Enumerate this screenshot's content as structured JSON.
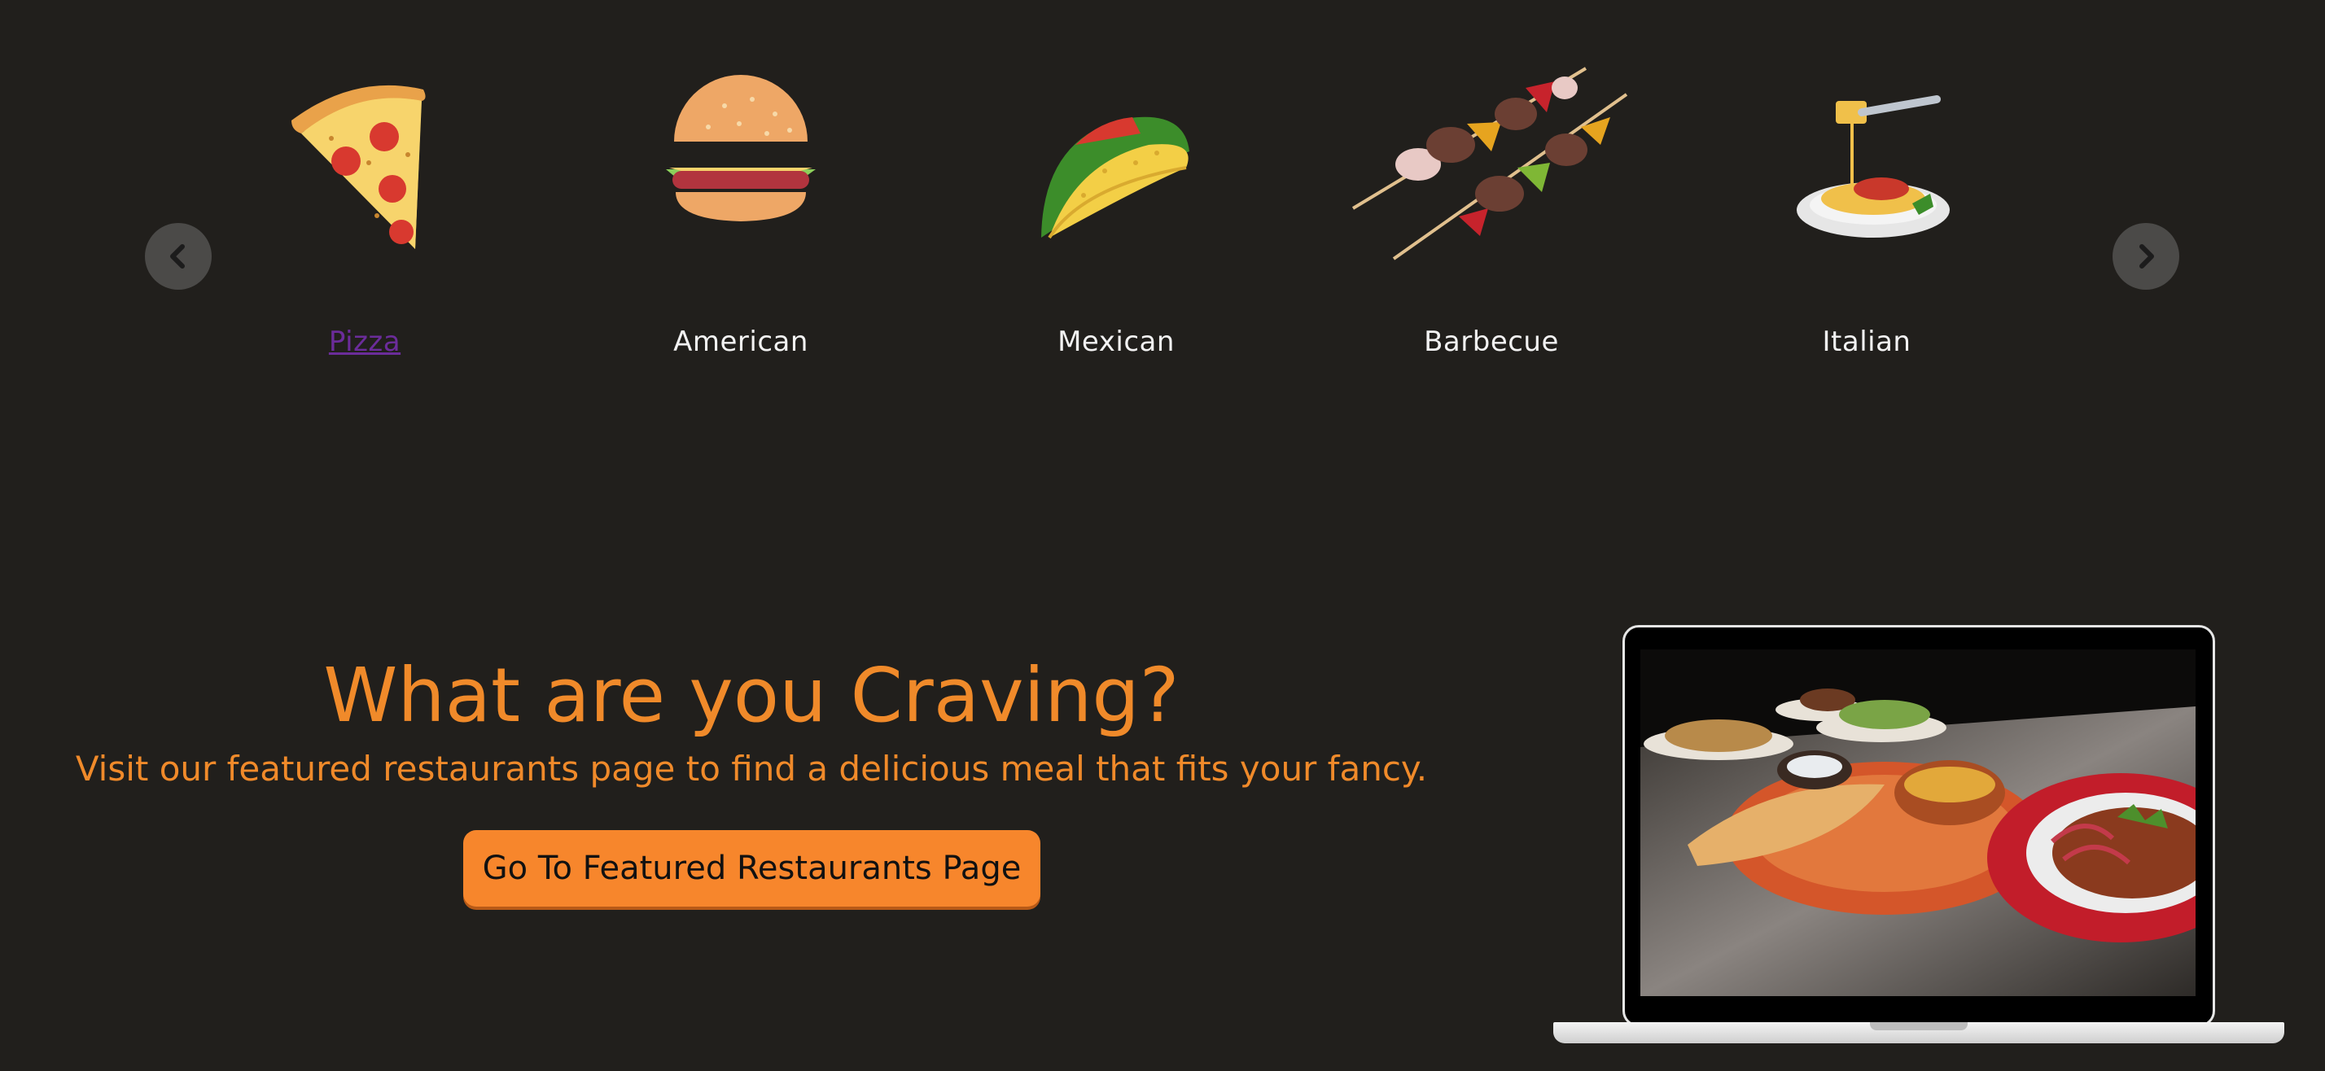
{
  "carousel": {
    "prev_icon": "chevron-left-icon",
    "next_icon": "chevron-right-icon",
    "categories": [
      {
        "label": "Pizza",
        "icon": "pizza-icon",
        "visited": true
      },
      {
        "label": "American",
        "icon": "burger-icon",
        "visited": false
      },
      {
        "label": "Mexican",
        "icon": "taco-icon",
        "visited": false
      },
      {
        "label": "Barbecue",
        "icon": "skewer-icon",
        "visited": false
      },
      {
        "label": "Italian",
        "icon": "spaghetti-icon",
        "visited": false
      }
    ]
  },
  "hero": {
    "title": "What are you Craving?",
    "subtitle": "Visit our featured restaurants page to find a delicious meal that fits your fancy.",
    "cta_label": "Go To Featured Restaurants Page",
    "image": "restaurant-dishes-photo"
  },
  "colors": {
    "background": "#211f1c",
    "accent": "#f08a2a",
    "button": "#f7862c",
    "label_text": "#f2f2f2",
    "visited_link": "#6b2c9a"
  }
}
